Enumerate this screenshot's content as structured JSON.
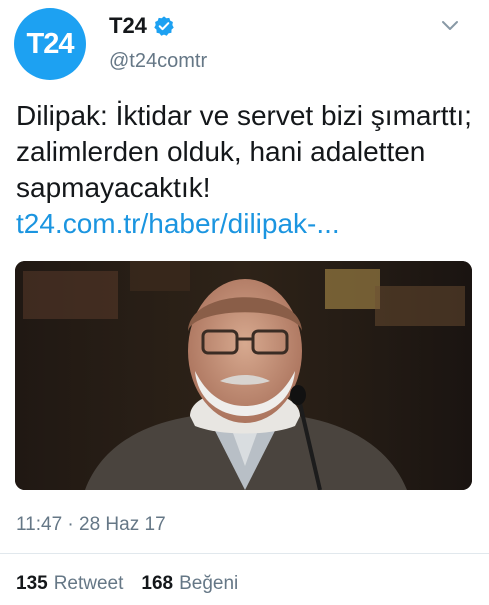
{
  "user": {
    "avatar_text": "T24",
    "name": "T24",
    "handle": "@t24comtr",
    "verified": true
  },
  "tweet": {
    "text": "Dilipak: İktidar ve servet bizi şımarttı; zalimlerden olduk, hani adaletten sapmayacaktık!",
    "link": "t24.com.tr/haber/dilipak-...",
    "timestamp": "11:47 · 28 Haz 17"
  },
  "stats": {
    "retweets_count": "135",
    "retweets_label": "Retweet",
    "likes_count": "168",
    "likes_label": "Beğeni"
  },
  "colors": {
    "brand": "#1da1f2",
    "link": "#1b95e0",
    "secondary_text": "#657786"
  },
  "icons": [
    "verified-badge-icon",
    "chevron-down-icon"
  ]
}
